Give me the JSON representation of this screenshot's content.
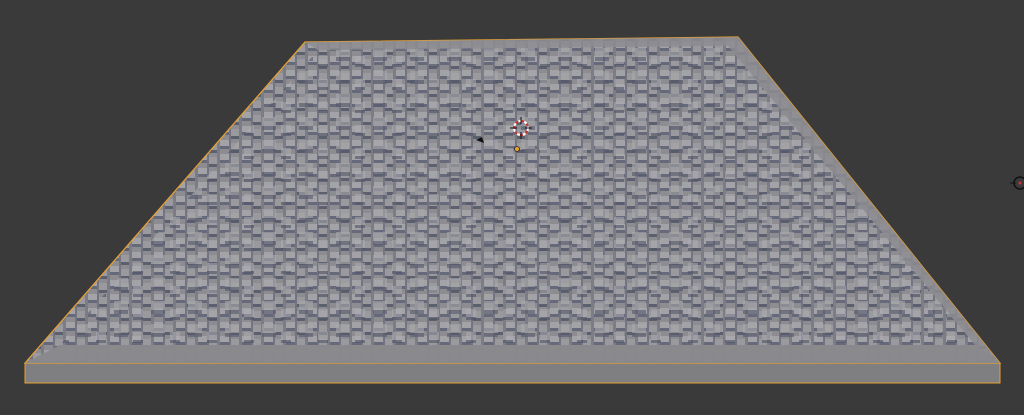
{
  "viewport": {
    "background_color": "#3a3a3a",
    "selection_outline_color": "#e8a030",
    "mesh_color": "#8a8a8e",
    "mesh_shadow_color": "#5e6170",
    "object": "city-mesh",
    "icons": [
      "3d-cursor-icon",
      "camera-icon",
      "light-icon",
      "object-origin-icon"
    ]
  }
}
